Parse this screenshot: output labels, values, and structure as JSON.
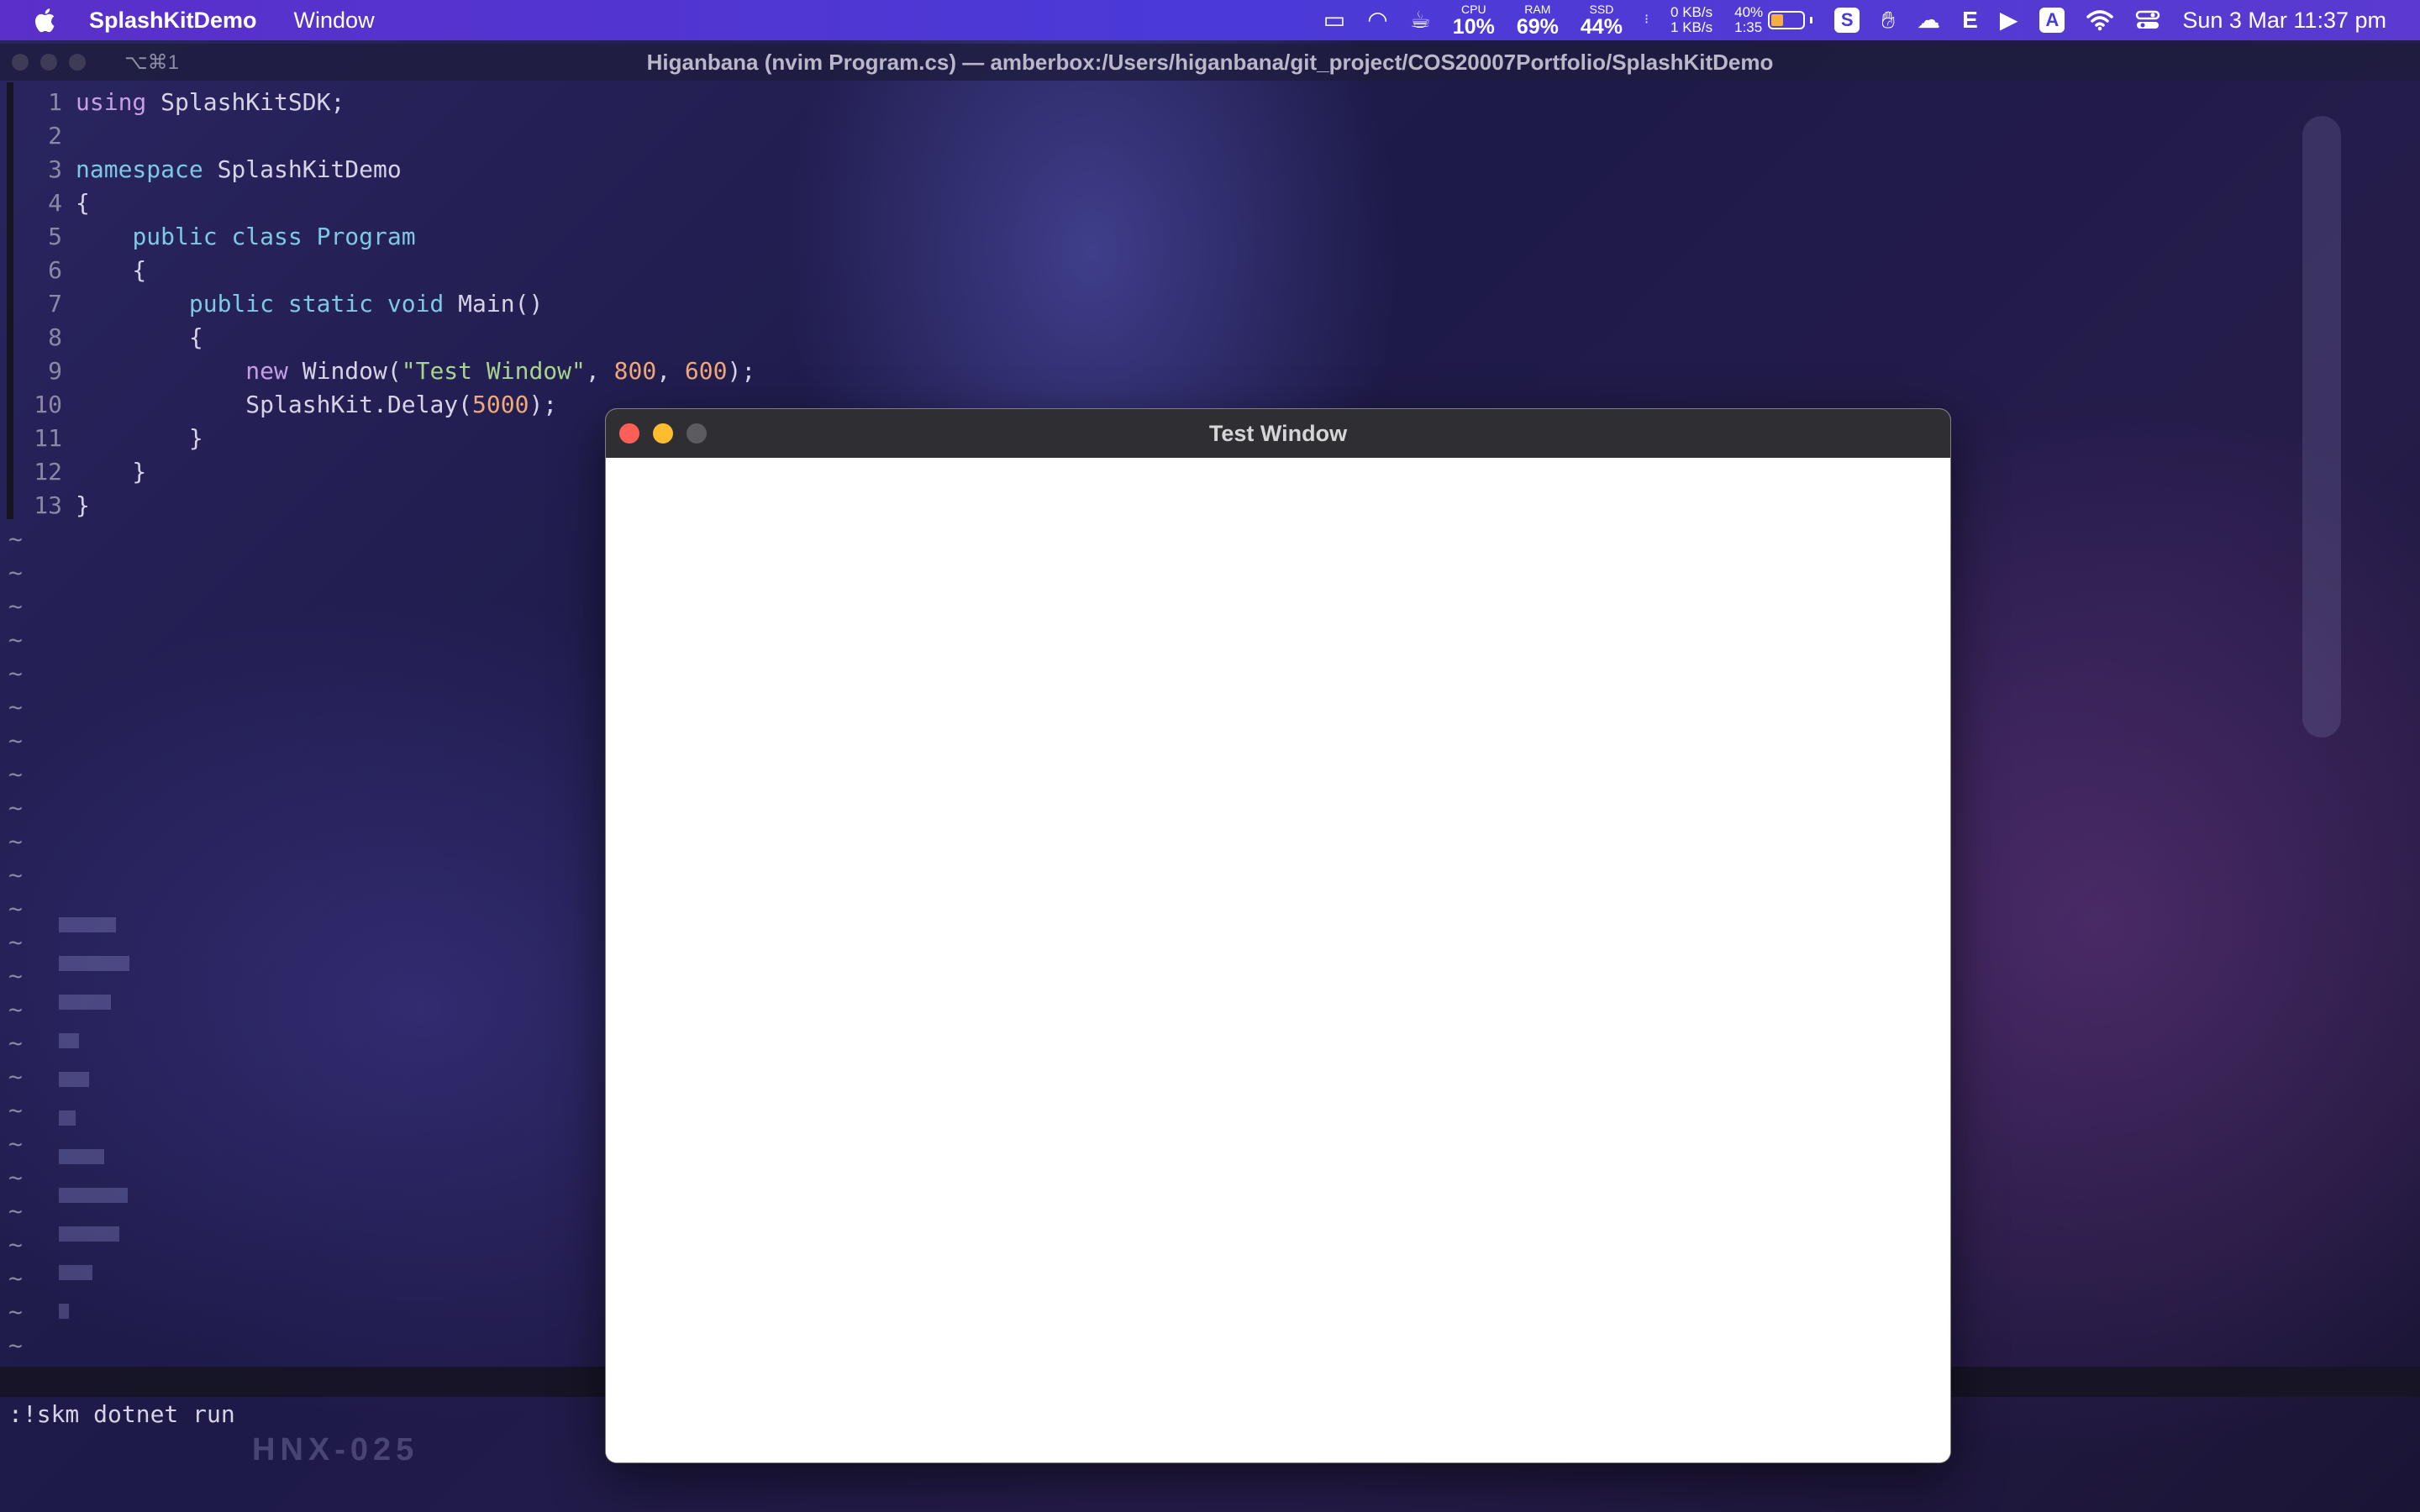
{
  "menubar": {
    "app_name": "SplashKitDemo",
    "menu_window": "Window",
    "cpu": {
      "label": "CPU",
      "value": "10%"
    },
    "ram": {
      "label": "RAM",
      "value": "69%"
    },
    "ssd": {
      "label": "SSD",
      "value": "44%"
    },
    "net_down": "0 KB/s",
    "net_up": "1 KB/s",
    "battery_percent": "40%",
    "battery_time": "1:35",
    "icon_s": "S",
    "icon_e": "E",
    "icon_a": "A",
    "clock": "Sun 3 Mar  11:37 pm"
  },
  "terminal": {
    "shortcut": "⌥⌘1",
    "title": "Higanbana (nvim Program.cs) — amberbox:/Users/higanbana/git_project/COS20007Portfolio/SplashKitDemo"
  },
  "editor": {
    "line_numbers": [
      "1",
      "2",
      "3",
      "4",
      "5",
      "6",
      "7",
      "8",
      "9",
      "10",
      "11",
      "12",
      "13"
    ],
    "l1_kw": "using",
    "l1_rest": " SplashKitSDK;",
    "l3_kw": "namespace",
    "l3_rest": " SplashKitDemo",
    "l4": "{",
    "l5_indent": "    ",
    "l5_kw": "public class",
    "l5_ty": " Program",
    "l6": "    {",
    "l7_indent": "        ",
    "l7_kw": "public static void",
    "l7_rest": " Main()",
    "l8": "        {",
    "l9_indent": "            ",
    "l9_kw": "new",
    "l9_a": " Window(",
    "l9_str": "\"Test Window\"",
    "l9_b": ", ",
    "l9_n1": "800",
    "l9_c": ", ",
    "l9_n2": "600",
    "l9_d": ");",
    "l10_indent": "            ",
    "l10_a": "SplashKit.Delay(",
    "l10_n": "5000",
    "l10_b": ");",
    "l11": "        }",
    "l12": "    }",
    "l13": "}",
    "tilde": "~",
    "command": ":!skm dotnet run"
  },
  "watermark": "HNX-025",
  "test_window": {
    "title": "Test Window"
  },
  "colors": {
    "menubar": "#4a3ad8",
    "keyword": "#c79ee6",
    "type": "#7ec8e3",
    "string": "#a8d38e",
    "number": "#f0a878",
    "close": "#ff5f57",
    "minimize": "#febc2e"
  }
}
